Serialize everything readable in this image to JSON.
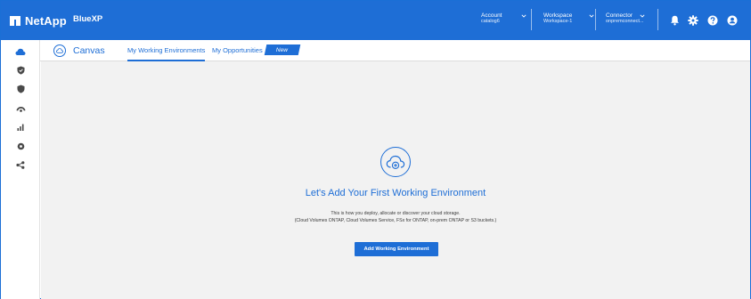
{
  "header": {
    "brand": "NetApp",
    "product": "BlueXP",
    "account": {
      "label": "Account",
      "value": "catalog6"
    },
    "workspace": {
      "label": "Workspace",
      "value": "Workspace-1"
    },
    "connector": {
      "label": "Connector",
      "value": "onpremconnect..."
    },
    "icons": [
      "bell-icon",
      "gear-icon",
      "help-icon",
      "user-icon"
    ]
  },
  "sidebar": {
    "items": [
      "storage-icon",
      "protection-icon",
      "governance-icon",
      "mobility-icon",
      "analytics-icon",
      "settings-icon",
      "share-icon"
    ]
  },
  "tabs": {
    "canvas_label": "Canvas",
    "items": [
      {
        "label": "My Working Environments",
        "active": true
      },
      {
        "label": "My Opportunities",
        "active": false
      }
    ],
    "new_badge": "New"
  },
  "main": {
    "title": "Let's Add Your First Working Environment",
    "desc_line1": "This is how you deploy, allocate or discover your cloud storage.",
    "desc_line2": "(Cloud Volumes ONTAP, Cloud Volumes Service, FSx for ONTAP, on-prem ONTAP or S3 buckets.)",
    "button_label": "Add Working Environment"
  },
  "colors": {
    "accent": "#1e6ed6",
    "canvas_bg": "#f2f2f2"
  }
}
